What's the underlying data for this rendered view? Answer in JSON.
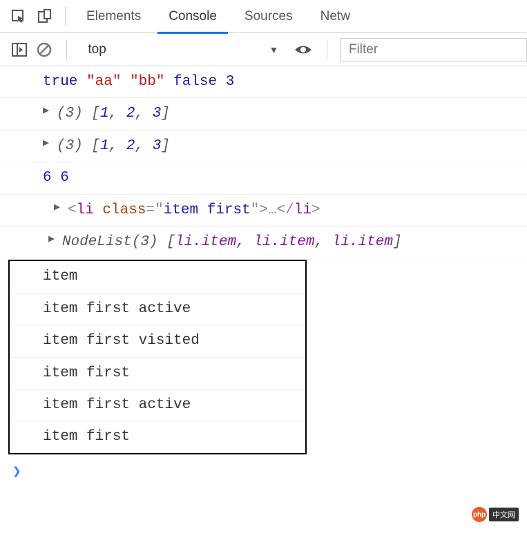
{
  "tabs": {
    "elements": "Elements",
    "console": "Console",
    "sources": "Sources",
    "network": "Netw"
  },
  "toolbar": {
    "context": "top",
    "filter_placeholder": "Filter"
  },
  "rows": {
    "r1_true": "true",
    "r1_aa": "\"aa\"",
    "r1_bb": "\"bb\"",
    "r1_false": "false",
    "r1_3": "3",
    "r2_count": "(3)",
    "r2_open": "[",
    "r2_v1": "1",
    "r2_comma": ", ",
    "r2_v2": "2",
    "r2_v3": "3",
    "r2_close": "]",
    "r3_count": "(3)",
    "r3_v1": "1",
    "r3_v2": "2",
    "r3_v3": "3",
    "r4_a": "6",
    "r4_b": "6",
    "r5_open": "<",
    "r5_tag": "li",
    "r5_sp": " class",
    "r5_eq": "=",
    "r5_q": "\"",
    "r5_val": "item first",
    "r5_close": ">",
    "r5_ellipsis": "…",
    "r5_endopen": "</",
    "r5_endtag": "li",
    "r5_endclose": ">",
    "r6_label": "NodeList(3)",
    "r6_open": " [",
    "r6_i1": "li.item",
    "r6_comma": ", ",
    "r6_i2": "li.item",
    "r6_i3": "li.item",
    "r6_close": "]",
    "b1": "item",
    "b2": "item first active",
    "b3": "item first visited",
    "b4": "item first",
    "b5": "item first active",
    "b6": "item first"
  },
  "watermark": {
    "logo": "php",
    "text": "中文网"
  }
}
